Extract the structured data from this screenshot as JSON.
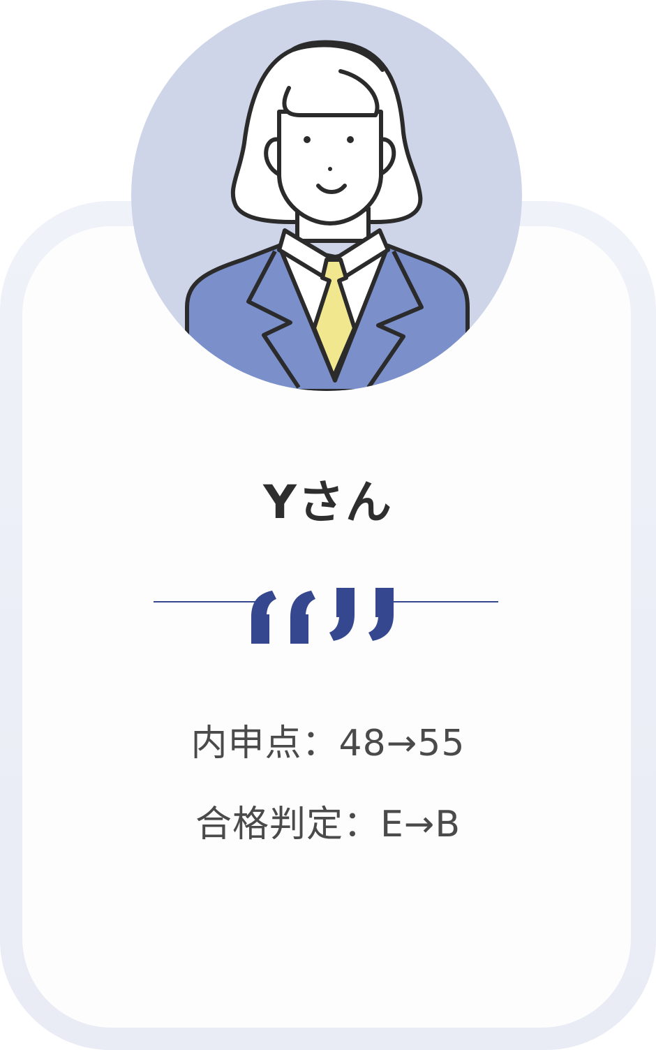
{
  "person": {
    "name": "Yさん",
    "avatar_icon": "businesswoman-avatar-icon"
  },
  "divider": {
    "icon": "quote-marks-icon",
    "color": "#34478f"
  },
  "stats": [
    {
      "text": "内申点：48→55"
    },
    {
      "text": "合格判定：E→B"
    }
  ],
  "colors": {
    "avatar_background": "#ced5e8",
    "suit": "#7b8fcb",
    "tie": "#f1e78f",
    "accent": "#34478f"
  }
}
